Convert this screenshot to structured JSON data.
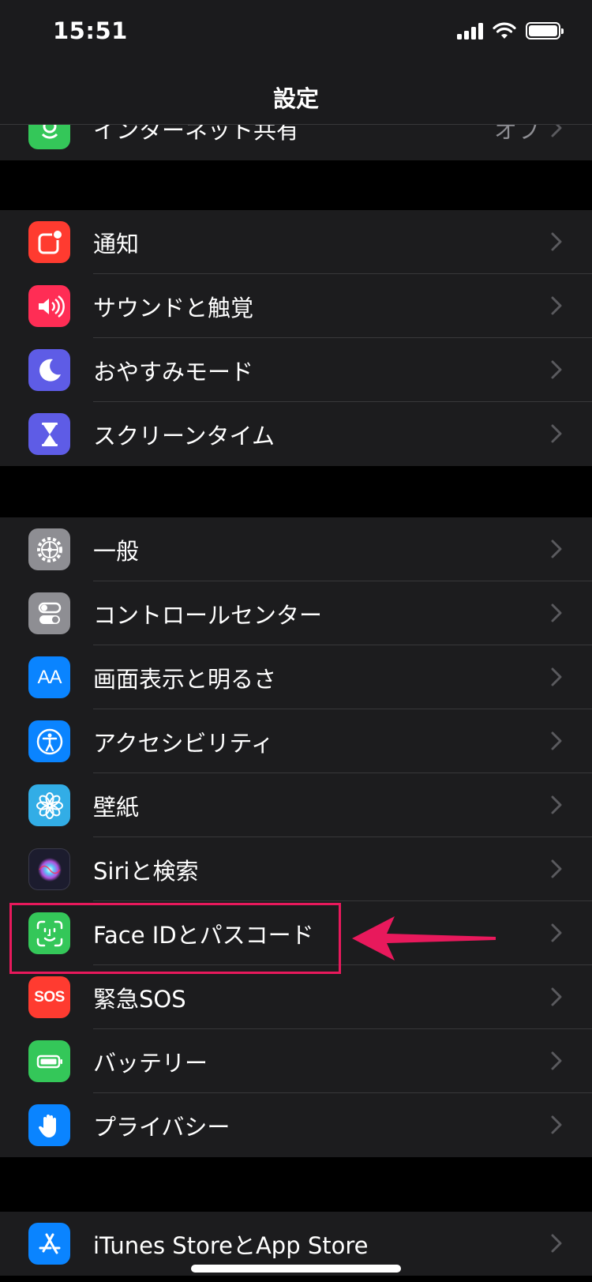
{
  "status": {
    "time": "15:51"
  },
  "nav": {
    "title": "設定"
  },
  "groups": [
    {
      "rows": [
        {
          "label": "インターネット共有",
          "value": "オフ",
          "icon": "personal-hotspot-icon",
          "color": "#34c759"
        }
      ]
    },
    {
      "rows": [
        {
          "label": "通知",
          "icon": "notifications-icon",
          "color": "#ff3b30"
        },
        {
          "label": "サウンドと触覚",
          "icon": "speaker-icon",
          "color": "#ff2d55"
        },
        {
          "label": "おやすみモード",
          "icon": "moon-icon",
          "color": "#5e5ce6"
        },
        {
          "label": "スクリーンタイム",
          "icon": "hourglass-icon",
          "color": "#5e5ce6"
        }
      ]
    },
    {
      "rows": [
        {
          "label": "一般",
          "icon": "gear-icon",
          "color": "#8e8e93"
        },
        {
          "label": "コントロールセンター",
          "icon": "toggles-icon",
          "color": "#8e8e93"
        },
        {
          "label": "画面表示と明るさ",
          "icon": "display-aa-icon",
          "icon_text": "AA",
          "color": "#0a84ff"
        },
        {
          "label": "アクセシビリティ",
          "icon": "accessibility-icon",
          "color": "#0a84ff"
        },
        {
          "label": "壁紙",
          "icon": "wallpaper-flower-icon",
          "color": "#32ade6"
        },
        {
          "label": "Siriと検索",
          "icon": "siri-icon",
          "color": "#1c1c2e"
        },
        {
          "label": "Face IDとパスコード",
          "icon": "face-id-icon",
          "color": "#34c759"
        },
        {
          "label": "緊急SOS",
          "icon": "sos-icon",
          "icon_text": "SOS",
          "color": "#ff3b30"
        },
        {
          "label": "バッテリー",
          "icon": "battery-icon",
          "color": "#34c759"
        },
        {
          "label": "プライバシー",
          "icon": "hand-icon",
          "color": "#0a84ff"
        }
      ]
    },
    {
      "rows": [
        {
          "label": "iTunes StoreとApp Store",
          "icon": "app-store-icon",
          "color": "#0a84ff"
        }
      ]
    }
  ]
}
